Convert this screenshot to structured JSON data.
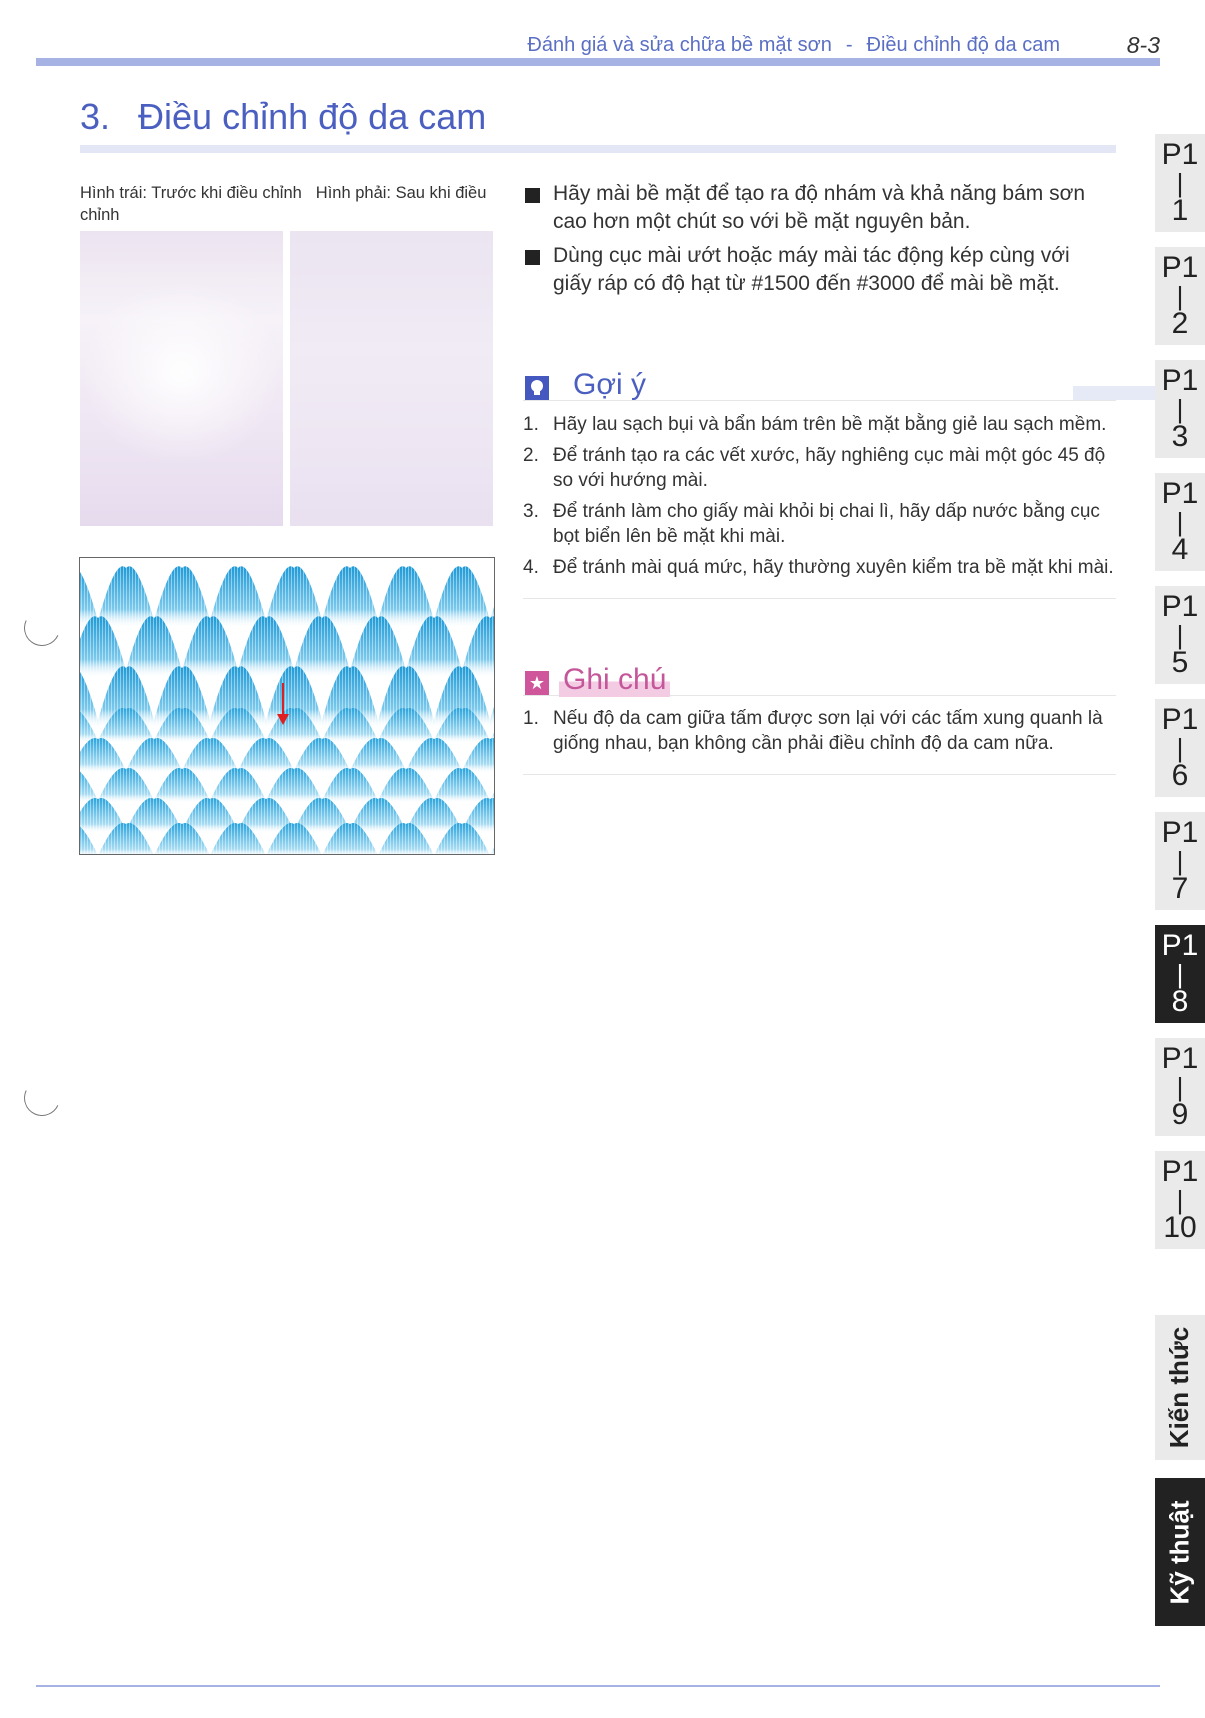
{
  "header": {
    "chapter": "Đánh giá và sửa chữa bề mặt sơn",
    "separator": "-",
    "section": "Điều chỉnh độ da cam",
    "page_number": "8-3"
  },
  "title": {
    "number": "3.",
    "text": "Điều chỉnh độ da cam"
  },
  "caption": {
    "left": "Hình trái: Trước khi điều chỉnh",
    "right": "Hình phải: Sau khi điều chỉnh"
  },
  "bullets": [
    "Hãy mài bề mặt để tạo ra độ nhám và khả năng bám sơn cao hơn một chút so với bề mặt nguyên bản.",
    "Dùng cục mài ướt hoặc máy mài tác động kép cùng với giấy ráp có độ hạt từ #1500 đến #3000 để mài bề mặt."
  ],
  "hint": {
    "label": "Gợi ý",
    "items": [
      {
        "n": "1.",
        "text": "Hãy lau sạch bụi và bẩn bám trên bề mặt bằng giẻ lau sạch mềm."
      },
      {
        "n": "2.",
        "text": "Để tránh tạo ra các vết xước, hãy nghiêng cục mài một góc 45 độ so với hướng mài."
      },
      {
        "n": "3.",
        "text": "Để tránh làm cho giấy mài khỏi bị chai lì, hãy dấp nước bằng cục bọt biển lên bề mặt khi mài."
      },
      {
        "n": "4.",
        "text": "Để tránh mài quá mức, hãy thường xuyên kiểm tra bề mặt khi mài."
      }
    ]
  },
  "note": {
    "label": "Ghi chú",
    "items": [
      {
        "n": "1.",
        "text": "Nếu độ da cam giữa tấm được sơn lại với các tấm xung quanh là giống nhau, bạn không cần phải điều chỉnh độ da cam nữa."
      }
    ]
  },
  "tabs": [
    {
      "a": "P1",
      "b": "|",
      "c": "1",
      "active": false
    },
    {
      "a": "P1",
      "b": "|",
      "c": "2",
      "active": false
    },
    {
      "a": "P1",
      "b": "|",
      "c": "3",
      "active": false
    },
    {
      "a": "P1",
      "b": "|",
      "c": "4",
      "active": false
    },
    {
      "a": "P1",
      "b": "|",
      "c": "5",
      "active": false
    },
    {
      "a": "P1",
      "b": "|",
      "c": "6",
      "active": false
    },
    {
      "a": "P1",
      "b": "|",
      "c": "7",
      "active": false
    },
    {
      "a": "P1",
      "b": "|",
      "c": "8",
      "active": true
    },
    {
      "a": "P1",
      "b": "|",
      "c": "9",
      "active": false
    },
    {
      "a": "P1",
      "b": "|",
      "c": "10",
      "active": false
    }
  ],
  "side_labels": {
    "knowledge": "Kiến thức",
    "technique": "Kỹ thuật"
  },
  "colors": {
    "accent": "#4a5fc0",
    "note_accent": "#c4569a",
    "rule": "#a6b1e4",
    "tab_bg": "#eaeaea",
    "tab_active": "#222222",
    "wave_top": "#2fa3d8",
    "arrow": "#e02020"
  }
}
